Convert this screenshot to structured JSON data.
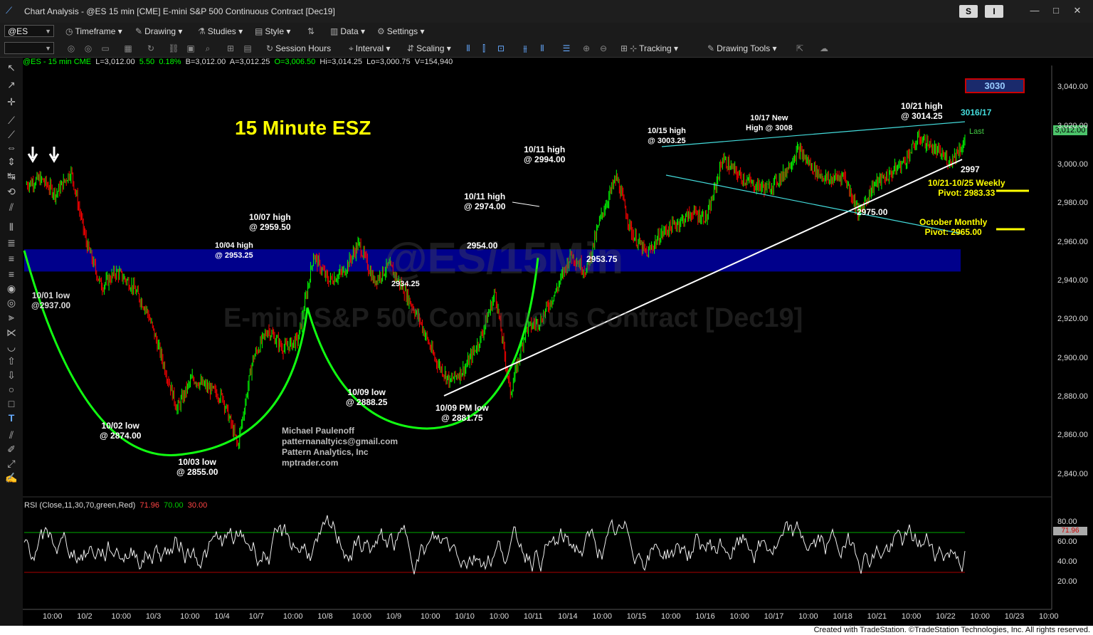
{
  "window": {
    "title": "Chart Analysis - @ES 15 min [CME] E-mini S&P 500 Continuous Contract [Dec19]",
    "btn_s": "S",
    "btn_i": "I"
  },
  "toolbar1": {
    "symbol": "@ES",
    "timeframe": "Timeframe",
    "drawing": "Drawing",
    "studies": "Studies",
    "style": "Style",
    "data": "Data",
    "settings": "Settings"
  },
  "toolbar2": {
    "session_hours": "Session Hours",
    "interval": "Interval",
    "scaling": "Scaling",
    "tracking": "Tracking",
    "drawing_tools": "Drawing Tools"
  },
  "infobar": {
    "symbol": "@ES - 15 min  CME",
    "last": "L=3,012.00",
    "change": "5.50",
    "pct": "0.18%",
    "bid": "B=3,012.00",
    "ask": "A=3,012.25",
    "open": "O=3,006.50",
    "high": "Hi=3,014.25",
    "low": "Lo=3,000.75",
    "volume": "V=154,940"
  },
  "chart_title": "15 Minute ESZ",
  "watermark": "@ES/15Min",
  "watermark2": "E-mini S&P 500 Continuous Contract [Dec19]",
  "credit": "Michael Paulenoff\npatternanaltyics@gmail.com\nPattern Analytics, Inc\nmptrader.com",
  "target_box": "3030",
  "annotations": {
    "a1001": "10/01 low\n@2937.00",
    "a1002": "10/02 low\n@ 2874.00",
    "a1003": "10/03 low\n@ 2855.00",
    "a1004": "10/04 high\n@ 2953.25",
    "a1007": "10/07 high\n@ 2959.50",
    "a2934": "2934.25",
    "a1009": "10/09 low\n@ 2888.25",
    "a2954": "2954.00",
    "a1009pm": "10/09 PM low\n@ 2881.75",
    "a1011a": "10/11 high\n@ 2974.00",
    "a1011b": "10/11 high\n@ 2994.00",
    "a2953": "2953.75",
    "a1015": "10/15 high\n@ 3003.25",
    "a1017": "10/17 New\nHigh @ 3008",
    "a1021": "10/21 high\n@ 3014.25",
    "a3016": "3016/17",
    "a2997": "2997",
    "a2975": "2975.00",
    "last": "Last",
    "weekly": "10/21-10/25 Weekly\nPivot: 2983.33",
    "monthly": "October Monthly\nPivot: 2965.00"
  },
  "price_tag": "3,012.00",
  "rsi": {
    "label": "RSI (Close,11,30,70,green,Red)",
    "value": "71.96",
    "upper": "70.00",
    "lower": "30.00",
    "tag": "71.96"
  },
  "y_axis": [
    "3,040.00",
    "3,020.00",
    "3,000.00",
    "2,980.00",
    "2,960.00",
    "2,940.00",
    "2,920.00",
    "2,900.00",
    "2,880.00",
    "2,860.00",
    "2,840.00"
  ],
  "rsi_axis": [
    "80.00",
    "60.00",
    "40.00",
    "20.00"
  ],
  "x_axis": [
    "10:00",
    "10/2",
    "10:00",
    "10/3",
    "10:00",
    "10/4",
    "10/7",
    "10:00",
    "10/8",
    "10:00",
    "10/9",
    "10:00",
    "10/10",
    "10:00",
    "10/11",
    "10/14",
    "10:00",
    "10/15",
    "10:00",
    "10/16",
    "10:00",
    "10/17",
    "10:00",
    "10/18",
    "10/21",
    "10:00",
    "10/22",
    "10:00",
    "10/23",
    "10:00"
  ],
  "footer": "Created with TradeStation. ©TradeStation Technologies, Inc. All rights reserved.",
  "chart_data": {
    "type": "line",
    "series": [
      {
        "values": [
          2990,
          2993,
          2985,
          2997,
          2960,
          2937,
          2945,
          2938,
          2925,
          2900,
          2874,
          2890,
          2885,
          2880,
          2855,
          2900,
          2915,
          2905,
          2910,
          2953.25,
          2940,
          2945,
          2959.5,
          2940,
          2948,
          2935,
          2920,
          2900,
          2888.25,
          2895,
          2910,
          2934.25,
          2881.75,
          2915,
          2920,
          2935,
          2954,
          2945,
          2974,
          2994,
          2965,
          2953.75,
          2965,
          2970,
          2975,
          2973,
          3003.25,
          2995,
          2990,
          2988,
          2995,
          3008,
          2998,
          2992,
          2995,
          2975,
          2990,
          2995,
          3002,
          3014.25,
          3008,
          3002,
          3012
        ]
      }
    ],
    "ylim": [
      2830,
      3050
    ],
    "colors": {
      "up": "#00ff00",
      "down": "#ff0000",
      "zone": "#00008b"
    }
  }
}
